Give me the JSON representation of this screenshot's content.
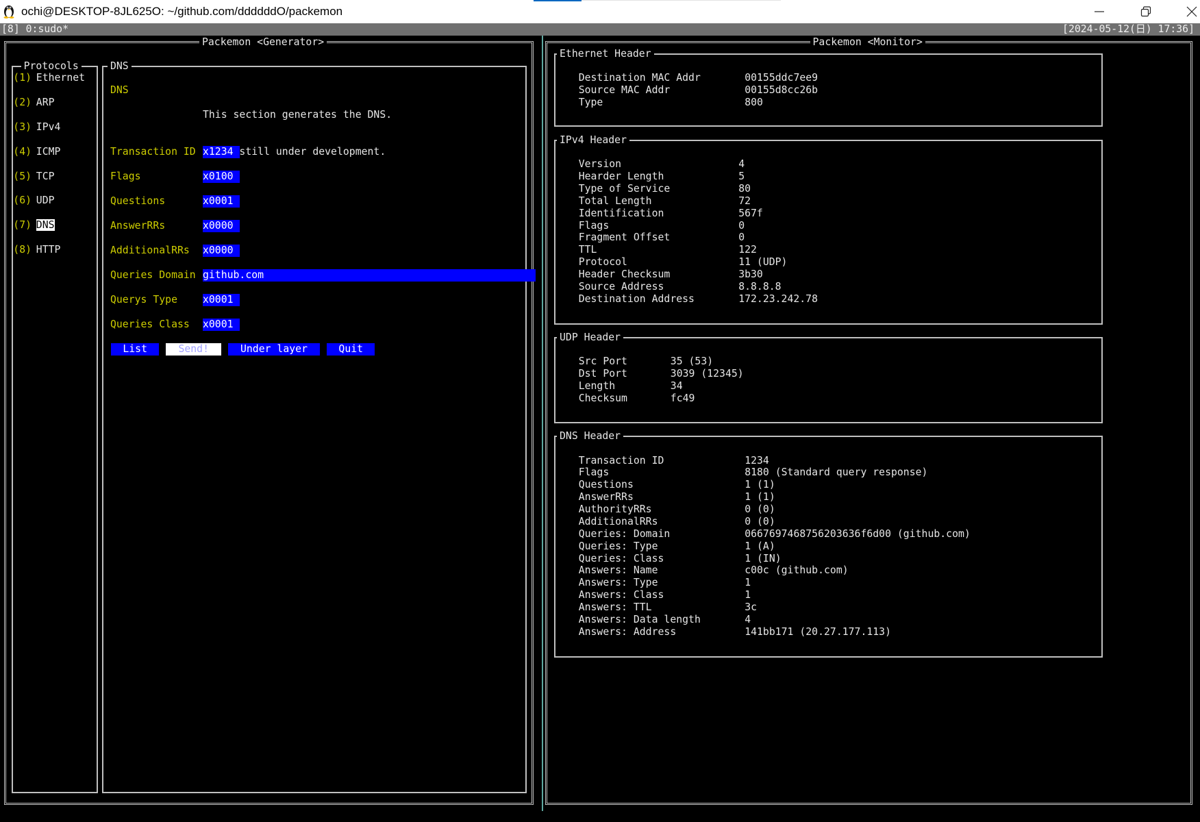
{
  "window": {
    "title": "ochi@DESKTOP-8JL625O: ~/github.com/ddddddO/packemon"
  },
  "tmux": {
    "window_list": "[8] 0:sudo*",
    "clock": "[2024-05-12(日) 17:36]"
  },
  "generator": {
    "title": "Packemon <Generator>",
    "protocols": {
      "title": "Protocols",
      "items": [
        {
          "key": "(1)",
          "label": "Ethernet",
          "selected": false
        },
        {
          "key": "(2)",
          "label": "ARP",
          "selected": false
        },
        {
          "key": "(3)",
          "label": "IPv4",
          "selected": false
        },
        {
          "key": "(4)",
          "label": "ICMP",
          "selected": false
        },
        {
          "key": "(5)",
          "label": "TCP",
          "selected": false
        },
        {
          "key": "(6)",
          "label": "UDP",
          "selected": false
        },
        {
          "key": "(7)",
          "label": "DNS",
          "selected": true
        },
        {
          "key": "(8)",
          "label": "HTTP",
          "selected": false
        }
      ]
    },
    "form": {
      "title": "DNS",
      "section_label": "DNS",
      "description": [
        "This section generates the DNS.",
        "It is still under development."
      ],
      "fields": [
        {
          "label": "Transaction ID",
          "value": "x1234"
        },
        {
          "label": "Flags",
          "value": "x0100"
        },
        {
          "label": "Questions",
          "value": "x0001"
        },
        {
          "label": "AnswerRRs",
          "value": "x0000"
        },
        {
          "label": "AdditionalRRs",
          "value": "x0000"
        },
        {
          "label": "Queries Domain",
          "value": "github.com"
        },
        {
          "label": "Querys Type",
          "value": "x0001"
        },
        {
          "label": "Queries Class",
          "value": "x0001"
        }
      ],
      "buttons": [
        {
          "label": "List",
          "focused": false
        },
        {
          "label": "Send!",
          "focused": true
        },
        {
          "label": "Under layer",
          "focused": false
        },
        {
          "label": "Quit",
          "focused": false
        }
      ]
    }
  },
  "monitor": {
    "title": "Packemon <Monitor>",
    "ethernet": {
      "title": "Ethernet Header",
      "rows": [
        {
          "label": "Destination MAC Addr",
          "value": "00155ddc7ee9"
        },
        {
          "label": "Source MAC Addr",
          "value": "00155d8cc26b"
        },
        {
          "label": "Type",
          "value": "800"
        }
      ]
    },
    "ipv4": {
      "title": "IPv4 Header",
      "rows": [
        {
          "label": "Version",
          "value": "4"
        },
        {
          "label": "Hearder Length",
          "value": "5"
        },
        {
          "label": "Type of Service",
          "value": "80"
        },
        {
          "label": "Total Length",
          "value": "72"
        },
        {
          "label": "Identification",
          "value": "567f"
        },
        {
          "label": "Flags",
          "value": "0"
        },
        {
          "label": "Fragment Offset",
          "value": "0"
        },
        {
          "label": "TTL",
          "value": "122"
        },
        {
          "label": "Protocol",
          "value": "11 (UDP)"
        },
        {
          "label": "Header Checksum",
          "value": "3b30"
        },
        {
          "label": "Source Address",
          "value": "8.8.8.8"
        },
        {
          "label": "Destination Address",
          "value": "172.23.242.78"
        }
      ]
    },
    "udp": {
      "title": "UDP Header",
      "rows": [
        {
          "label": "Src Port",
          "value": "35 (53)"
        },
        {
          "label": "Dst Port",
          "value": "3039 (12345)"
        },
        {
          "label": "Length",
          "value": "34"
        },
        {
          "label": "Checksum",
          "value": "fc49"
        }
      ]
    },
    "dns": {
      "title": "DNS Header",
      "rows": [
        {
          "label": "Transaction ID",
          "value": "1234"
        },
        {
          "label": "Flags",
          "value": "8180 (Standard query response)"
        },
        {
          "label": "Questions",
          "value": "1 (1)"
        },
        {
          "label": "AnswerRRs",
          "value": "1 (1)"
        },
        {
          "label": "AuthorityRRs",
          "value": "0 (0)"
        },
        {
          "label": "AdditionalRRs",
          "value": "0 (0)"
        },
        {
          "label": "Queries: Domain",
          "value": "0667697468756203636f6d00 (github.com)"
        },
        {
          "label": "Queries: Type",
          "value": "1 (A)"
        },
        {
          "label": "Queries: Class",
          "value": "1 (IN)"
        },
        {
          "label": "Answers: Name",
          "value": "c00c (github.com)"
        },
        {
          "label": "Answers: Type",
          "value": "1"
        },
        {
          "label": "Answers: Class",
          "value": "1"
        },
        {
          "label": "Answers: TTL",
          "value": "3c"
        },
        {
          "label": "Answers: Data length",
          "value": "4"
        },
        {
          "label": "Answers: Address",
          "value": "141bb171 (20.27.177.113)"
        }
      ]
    }
  },
  "colors": {
    "label_yellow": "#cdcd00",
    "field_blue": "#0000ff",
    "border": "#c0c0c0",
    "pane_divider": "#5fa8a0",
    "text": "#e6e6e6",
    "status_bar": "#707070",
    "accent": "#0067c0"
  },
  "icons": {
    "app": "linux-penguin-icon",
    "minimize": "minimize-icon",
    "restore": "restore-icon",
    "close": "close-icon"
  }
}
